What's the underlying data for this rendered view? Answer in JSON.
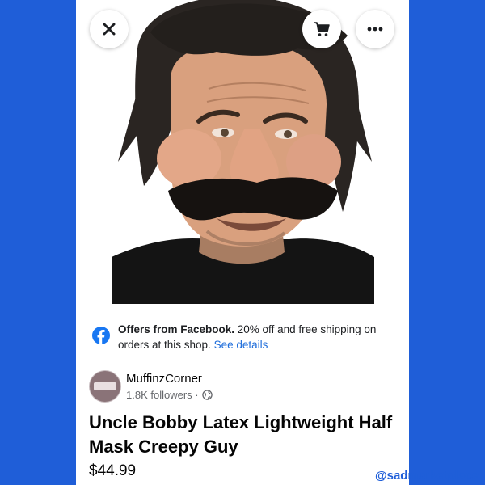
{
  "product": {
    "image_alt": "Uncle Bobby latex half mask photo"
  },
  "offer": {
    "brand": "Offers from Facebook.",
    "text": " 20% off and free shipping on orders at this shop. ",
    "link": "See details"
  },
  "seller": {
    "name": "MuffinzCorner",
    "followers": "1.8K followers ·"
  },
  "listing": {
    "title": "Uncle Bobby Latex Lightweight Half Mask Creepy Guy",
    "price": "$44.99"
  },
  "watermark": "@sadmarketplace",
  "icons": {
    "close": "close-icon",
    "cart": "cart-icon",
    "more": "more-icon",
    "facebook": "facebook-icon",
    "globe": "globe-icon"
  },
  "colors": {
    "background": "#1f5ed8",
    "link": "#216fdb",
    "facebook": "#1877f2"
  }
}
